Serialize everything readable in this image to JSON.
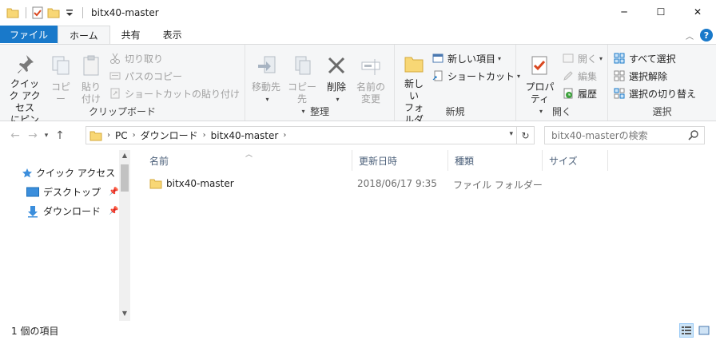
{
  "window": {
    "title": "bitx40-master",
    "minimize_glyph": "─",
    "maximize_glyph": "☐",
    "close_glyph": "✕"
  },
  "tabs": {
    "file": "ファイル",
    "home": "ホーム",
    "share": "共有",
    "view": "表示"
  },
  "ribbon": {
    "clipboard": {
      "label": "クリップボード",
      "pin_line1": "クイック アクセス",
      "pin_line2": "にピン留め",
      "copy": "コピー",
      "paste": "貼り付け",
      "cut": "切り取り",
      "copy_path": "パスのコピー",
      "paste_shortcut": "ショートカットの貼り付け"
    },
    "organize": {
      "label": "整理",
      "move_to": "移動先",
      "copy_to": "コピー先",
      "delete": "削除",
      "rename_line1": "名前の",
      "rename_line2": "変更"
    },
    "new": {
      "label": "新規",
      "new_folder_line1": "新しい",
      "new_folder_line2": "フォルダー",
      "new_item": "新しい項目",
      "shortcut": "ショートカット"
    },
    "open": {
      "label": "開く",
      "properties": "プロパティ",
      "open": "開く",
      "edit": "編集",
      "history": "履歴"
    },
    "select": {
      "label": "選択",
      "select_all": "すべて選択",
      "select_none": "選択解除",
      "invert": "選択の切り替え"
    }
  },
  "address": {
    "crumbs": [
      "PC",
      "ダウンロード",
      "bitx40-master"
    ],
    "search_placeholder": "bitx40-masterの検索"
  },
  "nav_pane": {
    "items": [
      {
        "label": "クイック アクセス"
      },
      {
        "label": "デスクトップ"
      },
      {
        "label": "ダウンロード"
      }
    ]
  },
  "file_list": {
    "columns": [
      "名前",
      "更新日時",
      "種類",
      "サイズ"
    ],
    "rows": [
      {
        "name": "bitx40-master",
        "modified": "2018/06/17 9:35",
        "type": "ファイル フォルダー",
        "size": ""
      }
    ]
  },
  "status": {
    "item_count": "1 個の項目"
  },
  "colors": {
    "accent": "#1979ca",
    "folder": "#f8d775",
    "ribbon_bg": "#f5f6f7"
  }
}
